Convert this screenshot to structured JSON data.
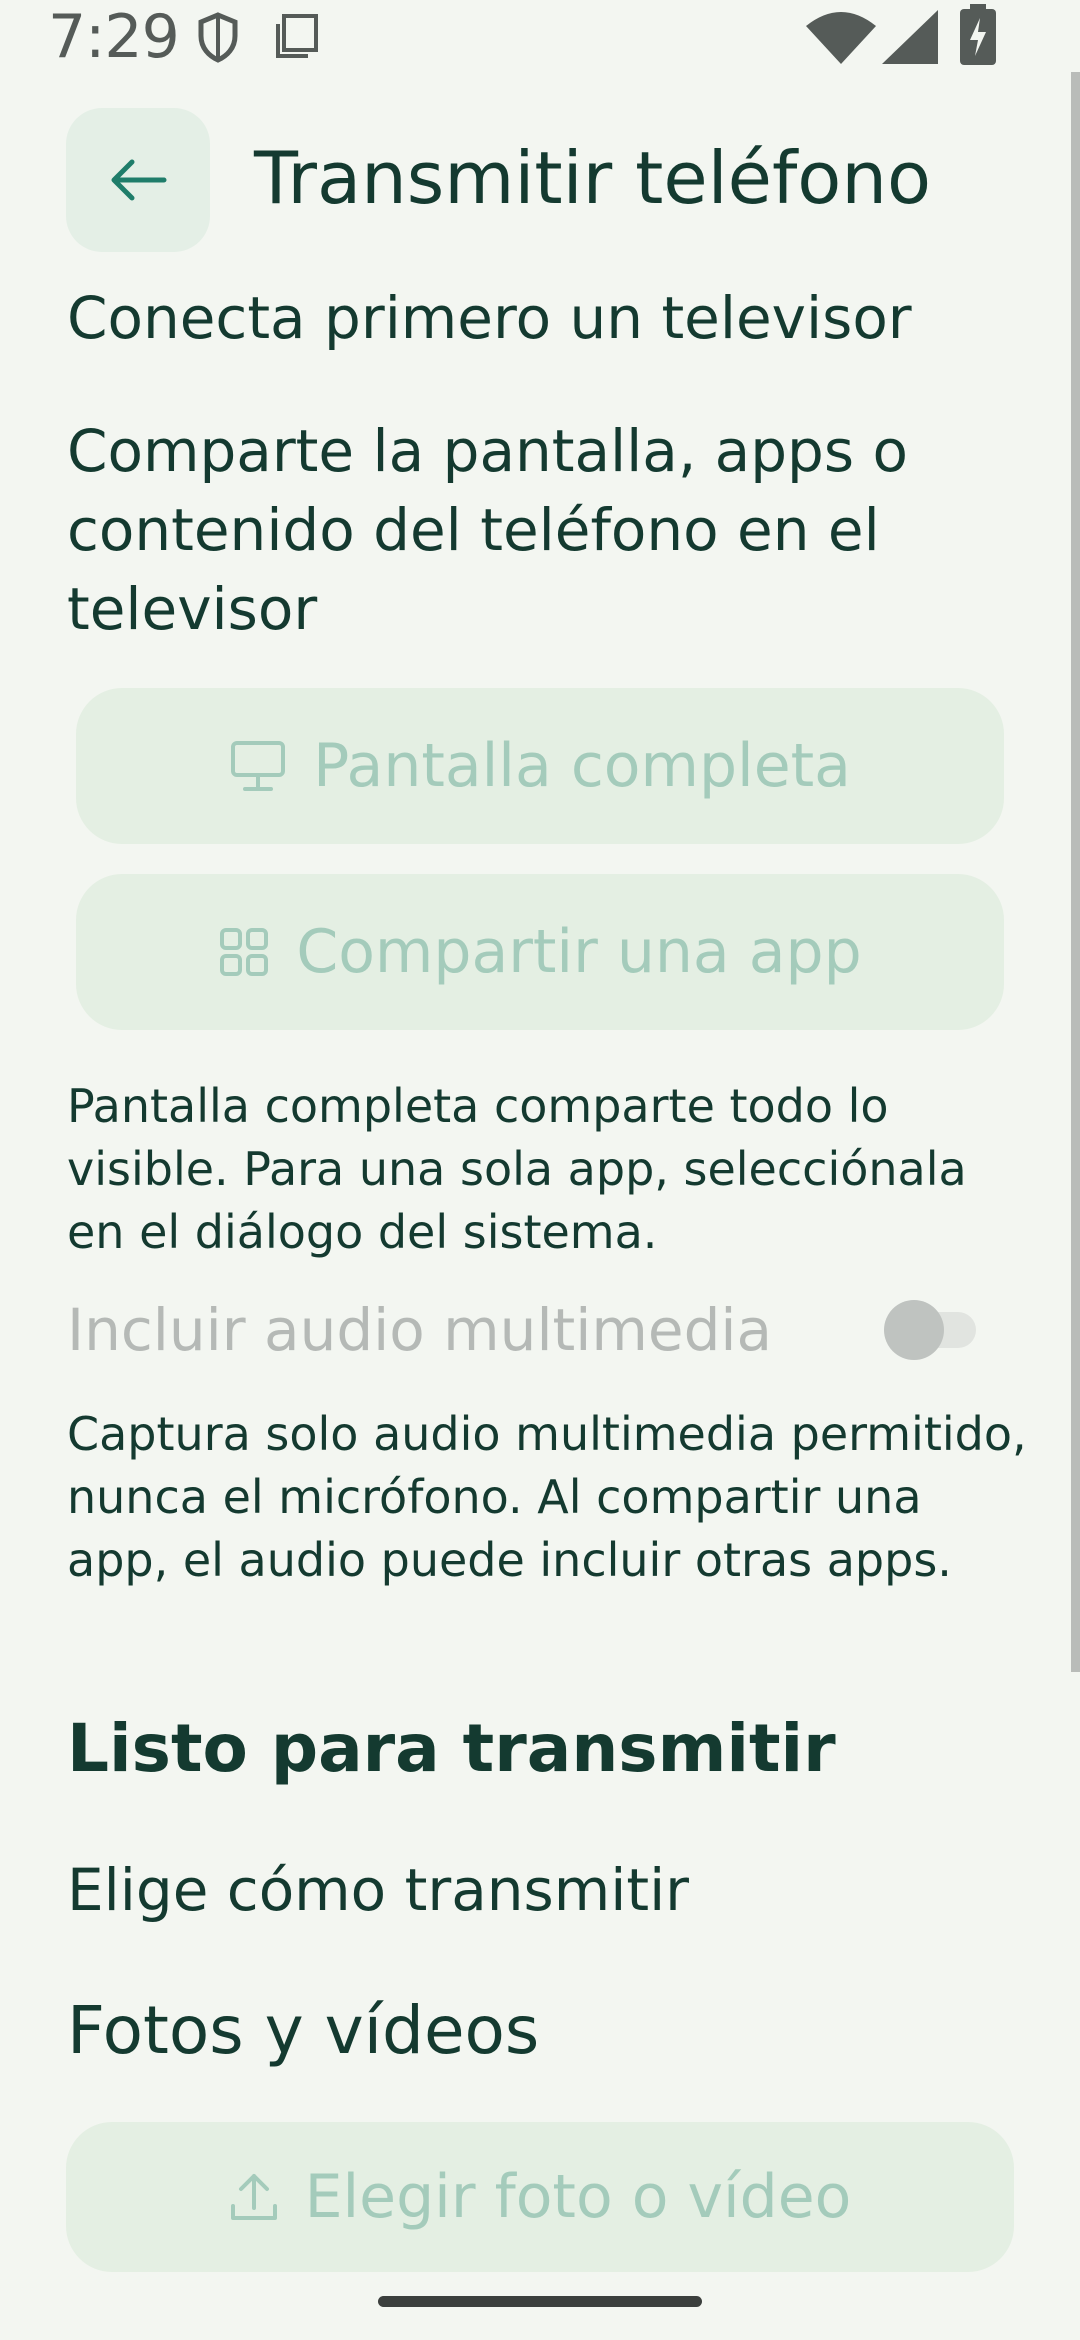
{
  "status_bar": {
    "time": "7:29",
    "icons": [
      "shield-icon",
      "screenshot-icon",
      "wifi-icon",
      "signal-icon",
      "battery-charging-icon"
    ]
  },
  "header": {
    "back_icon": "arrow-left-icon",
    "title": "Transmitir teléfono"
  },
  "content": {
    "subtitle": "Conecta primero un televisor",
    "description": "Comparte la pantalla, apps o contenido del teléfono en el televisor",
    "full_screen_button": {
      "label": "Pantalla completa",
      "icon": "monitor-icon",
      "enabled": false
    },
    "share_app_button": {
      "label": "Compartir una app",
      "icon": "grid-icon",
      "enabled": false
    },
    "help_text": "Pantalla completa comparte todo lo visible. Para una sola app, selecciónala en el diálogo del sistema.",
    "audio": {
      "label": "Incluir audio multimedia",
      "enabled": false,
      "checked": false,
      "help": "Captura solo audio multimedia permitido, nunca el micrófono. Al compartir una app, el audio puede incluir otras apps."
    },
    "ready_heading": "Listo para transmitir",
    "choose_label": "Elige cómo transmitir",
    "photos_heading": "Fotos y vídeos",
    "photo_button": {
      "label": "Elegir foto o vídeo",
      "icon": "upload-icon",
      "enabled": false
    }
  },
  "colors": {
    "background": "#f3f6f1",
    "text": "#143a30",
    "accent": "#1f7d6a",
    "disabled_text": "#a4cbbb",
    "button_bg": "#e4efe3"
  }
}
